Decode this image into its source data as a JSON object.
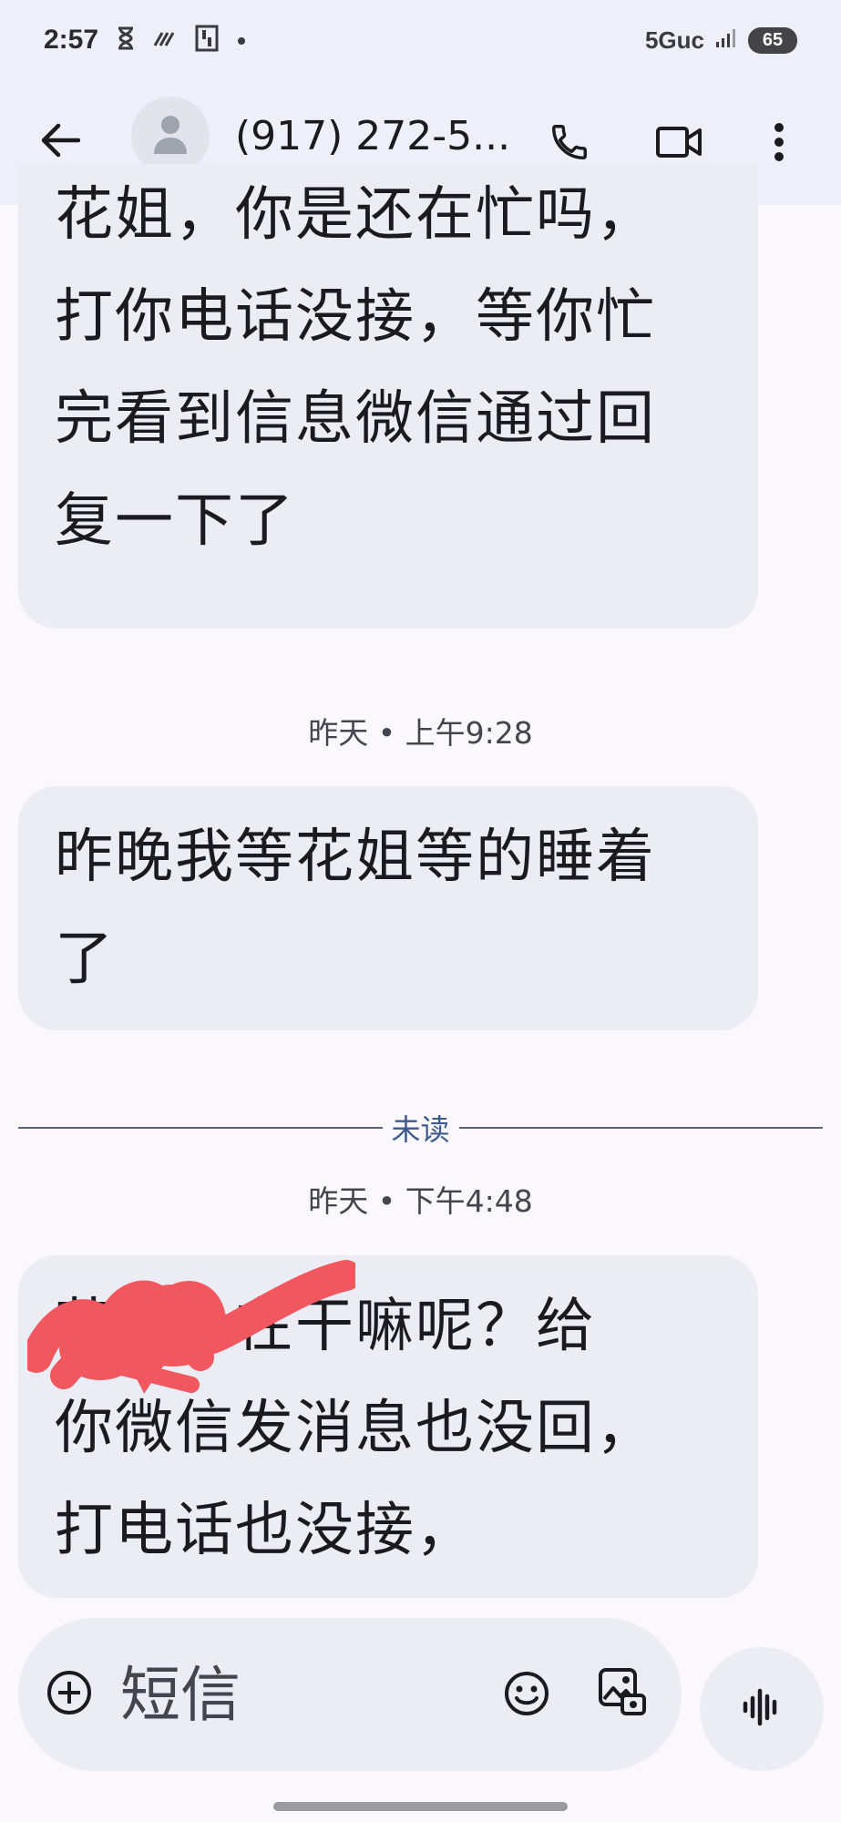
{
  "status_bar": {
    "time": "2:57",
    "network": "5Guc",
    "battery": "65"
  },
  "header": {
    "contact": "(917) 272-5...",
    "back_icon": "arrow-back-icon",
    "call_icon": "phone-icon",
    "video_icon": "video-call-icon",
    "more_icon": "more-vert-icon"
  },
  "messages": [
    {
      "text": "花姐，你是还在忙吗，\n打你电话没接，等你忙\n完看到信息微信通过回\n复一下了"
    },
    {
      "text": "昨晚我等花姐等的睡着\n了"
    },
    {
      "text": "花姐，在干嘛呢？给\n你微信发消息也没回，\n打电话也没接，",
      "partially_obscured": true
    }
  ],
  "timestamps": [
    {
      "day": "昨天",
      "time": "上午9:28"
    },
    {
      "day": "昨天",
      "time": "下午4:48"
    }
  ],
  "unread_label": "未读",
  "composer": {
    "placeholder": "短信",
    "icons": [
      "add-icon",
      "emoji-icon",
      "gallery-icon",
      "voice-icon"
    ]
  },
  "colors": {
    "header_bg": "#edf0f8",
    "bubble_bg": "#ecedf4",
    "page_bg": "#fbf8fd",
    "unread_accent": "#3f5a8c",
    "scribble": "#f0575f"
  }
}
